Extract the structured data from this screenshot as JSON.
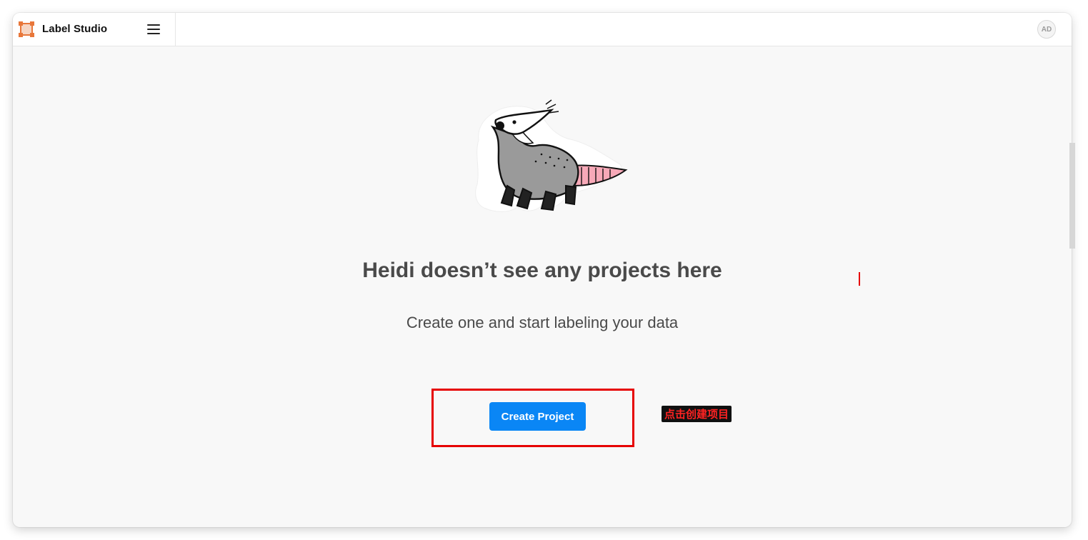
{
  "header": {
    "app_name": "Label Studio",
    "logo_icon": "label-studio-logo-icon",
    "menu_icon": "hamburger-menu-icon",
    "avatar_initials": "AD"
  },
  "empty_state": {
    "illustration": "opossum-mascot-illustration",
    "title": "Heidi doesn’t see any projects here",
    "subtitle": "Create one and start labeling your data",
    "create_button_label": "Create Project"
  },
  "annotation": {
    "label": "点击创建项目",
    "highlight_color": "#e60000"
  },
  "colors": {
    "accent": "#0a86f5",
    "logo": "#e8773a",
    "annotation_text": "#ff2222"
  }
}
